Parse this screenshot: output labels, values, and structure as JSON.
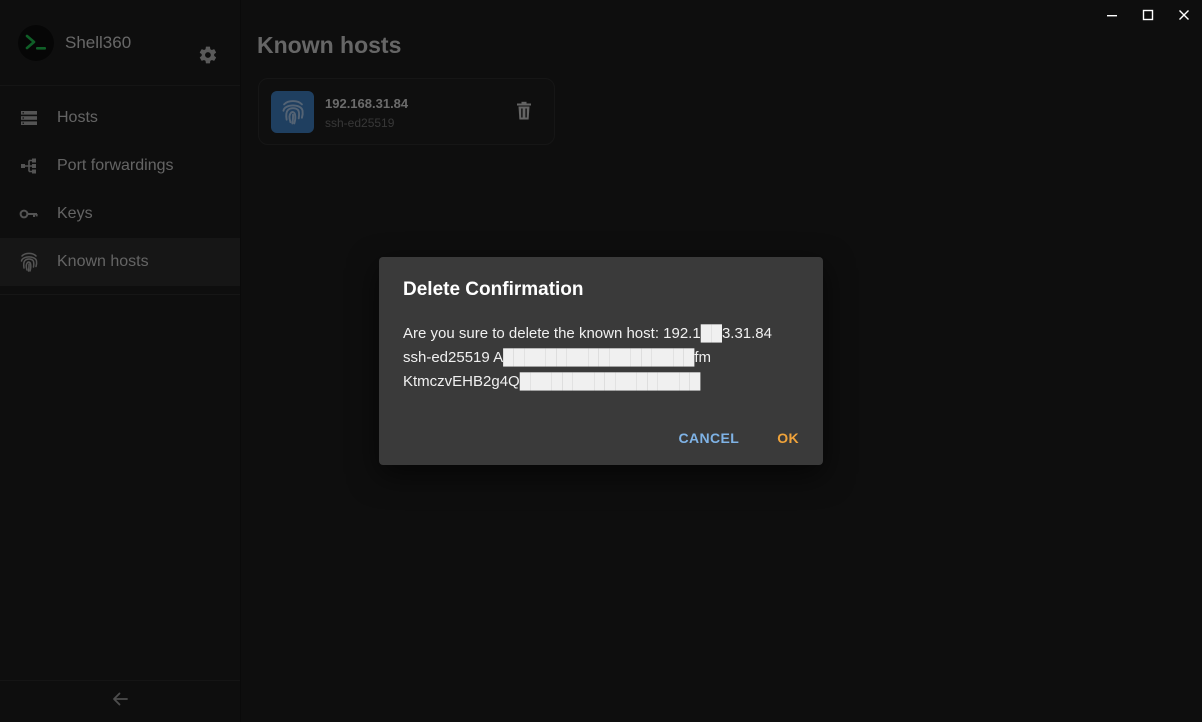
{
  "app": {
    "name": "Shell360"
  },
  "sidebar": {
    "items": [
      {
        "label": "Hosts",
        "icon": "hosts-icon",
        "active": false
      },
      {
        "label": "Port forwardings",
        "icon": "port-forwarding-icon",
        "active": false
      },
      {
        "label": "Keys",
        "icon": "key-icon",
        "active": false
      },
      {
        "label": "Known hosts",
        "icon": "fingerprint-icon",
        "active": true
      }
    ]
  },
  "main": {
    "title": "Known hosts",
    "hosts": [
      {
        "address": "192.168.31.84",
        "key_type": "ssh-ed25519"
      }
    ]
  },
  "dialog": {
    "title": "Delete Confirmation",
    "message_lines": [
      "Are you sure to delete the known host: 192.1██3.31.84",
      "ssh-ed25519 A██████████████████fm",
      "KtmczvEHB2g4Q█████████████████"
    ],
    "cancel_label": "CANCEL",
    "ok_label": "OK"
  },
  "colors": {
    "accent_blue": "#7fb3e6",
    "accent_orange": "#f0a33a",
    "avatar_blue": "#3e7fc1",
    "logo_green": "#1fbf4f"
  }
}
